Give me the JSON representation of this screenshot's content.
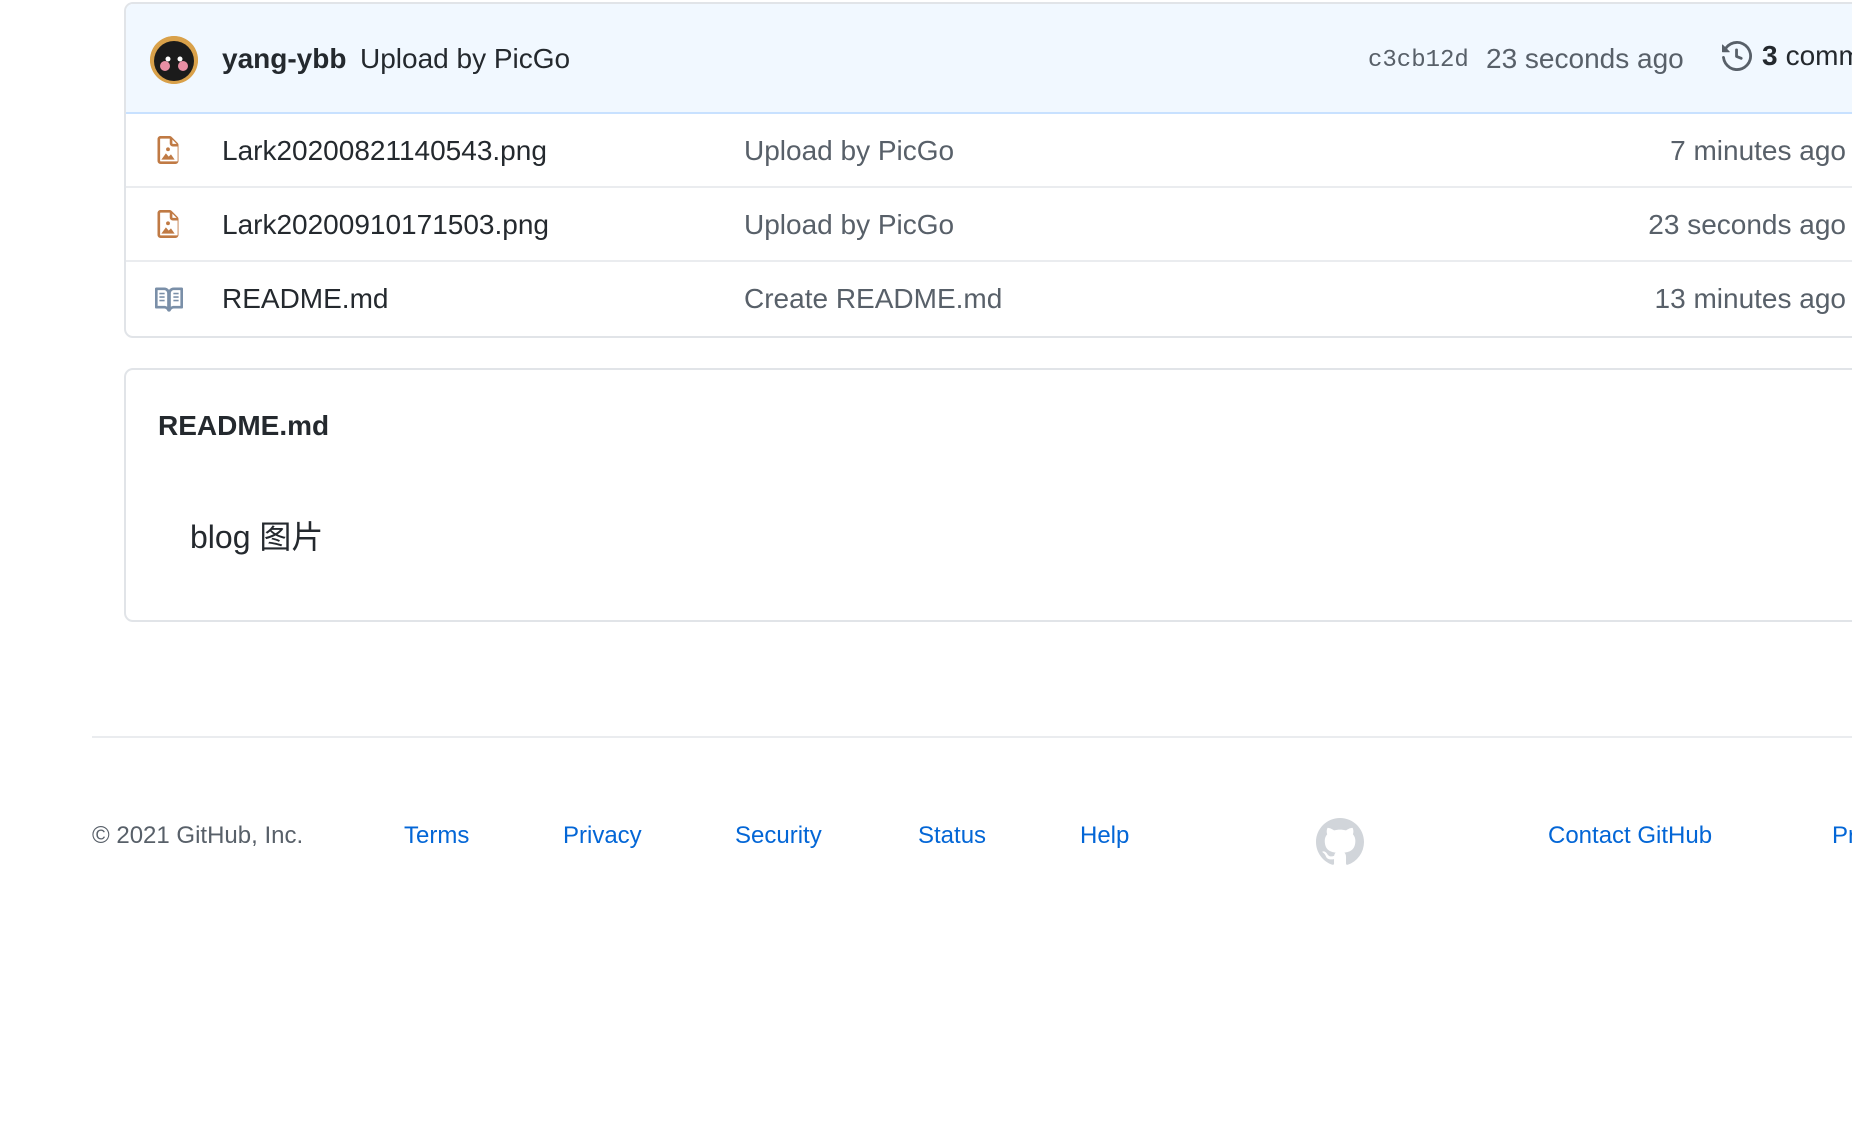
{
  "latest_commit": {
    "author": "yang-ybb",
    "message": "Upload by PicGo",
    "sha": "c3cb12d",
    "time": "23 seconds ago",
    "count": "3",
    "count_label": "commits"
  },
  "files": [
    {
      "name": "Lark20200821140543.png",
      "commit_message": "Upload by PicGo",
      "time": "7 minutes ago",
      "icon": "file-media-icon"
    },
    {
      "name": "Lark20200910171503.png",
      "commit_message": "Upload by PicGo",
      "time": "23 seconds ago",
      "icon": "file-media-icon"
    },
    {
      "name": "README.md",
      "commit_message": "Create README.md",
      "time": "13 minutes ago",
      "icon": "book-icon"
    }
  ],
  "readme": {
    "title": "README.md",
    "content": "blog 图片"
  },
  "footer": {
    "copyright": "© 2021 GitHub, Inc.",
    "links_left": [
      "Terms",
      "Privacy",
      "Security",
      "Status",
      "Help"
    ],
    "links_right": [
      "Contact GitHub",
      "Pricing"
    ]
  },
  "colors": {
    "link": "#0366d6",
    "header_bg": "#f1f8ff",
    "media_icon": "#c07a44",
    "book_icon": "#7a8fa8"
  }
}
